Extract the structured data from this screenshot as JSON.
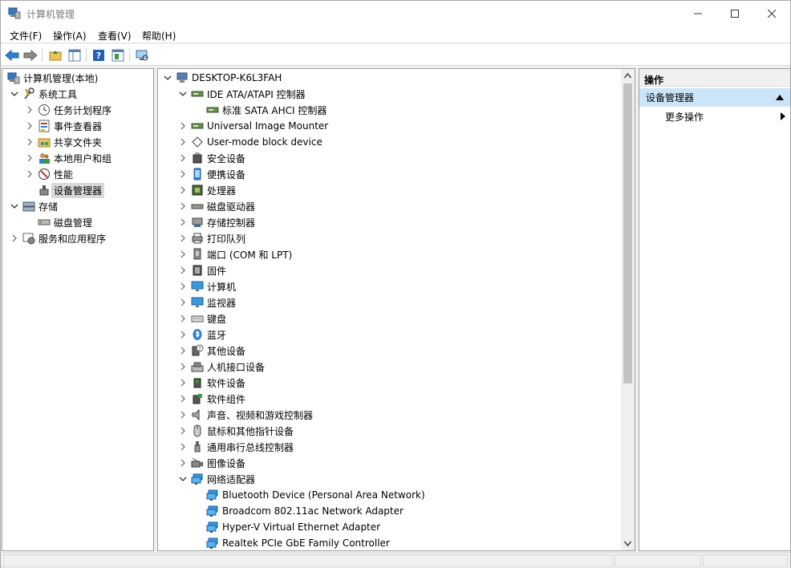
{
  "window": {
    "title": "计算机管理"
  },
  "menu": [
    "文件(F)",
    "操作(A)",
    "查看(V)",
    "帮助(H)"
  ],
  "left_tree": [
    {
      "label": "计算机管理(本地)",
      "level": 0,
      "chev": "",
      "icon": "computer-management-icon"
    },
    {
      "label": "系统工具",
      "level": 1,
      "chev": "down",
      "icon": "tools-icon"
    },
    {
      "label": "任务计划程序",
      "level": 2,
      "chev": "right",
      "icon": "clock-icon"
    },
    {
      "label": "事件查看器",
      "level": 2,
      "chev": "right",
      "icon": "event-viewer-icon"
    },
    {
      "label": "共享文件夹",
      "level": 2,
      "chev": "right",
      "icon": "shared-folder-icon"
    },
    {
      "label": "本地用户和组",
      "level": 2,
      "chev": "right",
      "icon": "users-icon"
    },
    {
      "label": "性能",
      "level": 2,
      "chev": "right",
      "icon": "performance-icon"
    },
    {
      "label": "设备管理器",
      "level": 2,
      "chev": "",
      "icon": "device-manager-icon",
      "selected": true
    },
    {
      "label": "存储",
      "level": 1,
      "chev": "down",
      "icon": "storage-icon"
    },
    {
      "label": "磁盘管理",
      "level": 2,
      "chev": "",
      "icon": "disk-management-icon"
    },
    {
      "label": "服务和应用程序",
      "level": 1,
      "chev": "right",
      "icon": "services-icon"
    }
  ],
  "device_tree": [
    {
      "label": "DESKTOP-K6L3FAH",
      "level": 0,
      "chev": "down",
      "icon": "computer-icon"
    },
    {
      "label": "IDE ATA/ATAPI 控制器",
      "level": 1,
      "chev": "down",
      "icon": "ide-controller-icon"
    },
    {
      "label": "标准 SATA AHCI 控制器",
      "level": 2,
      "chev": "",
      "icon": "ide-controller-icon"
    },
    {
      "label": "Universal Image Mounter",
      "level": 1,
      "chev": "right",
      "icon": "ide-controller-icon"
    },
    {
      "label": "User-mode block device",
      "level": 1,
      "chev": "right",
      "icon": "block-device-icon"
    },
    {
      "label": "安全设备",
      "level": 1,
      "chev": "right",
      "icon": "security-device-icon"
    },
    {
      "label": "便携设备",
      "level": 1,
      "chev": "right",
      "icon": "portable-device-icon"
    },
    {
      "label": "处理器",
      "level": 1,
      "chev": "right",
      "icon": "processor-icon"
    },
    {
      "label": "磁盘驱动器",
      "level": 1,
      "chev": "right",
      "icon": "disk-drive-icon"
    },
    {
      "label": "存储控制器",
      "level": 1,
      "chev": "right",
      "icon": "storage-controller-icon"
    },
    {
      "label": "打印队列",
      "level": 1,
      "chev": "right",
      "icon": "printer-icon"
    },
    {
      "label": "端口 (COM 和 LPT)",
      "level": 1,
      "chev": "right",
      "icon": "port-icon"
    },
    {
      "label": "固件",
      "level": 1,
      "chev": "right",
      "icon": "firmware-icon"
    },
    {
      "label": "计算机",
      "level": 1,
      "chev": "right",
      "icon": "monitor-icon"
    },
    {
      "label": "监视器",
      "level": 1,
      "chev": "right",
      "icon": "monitor-icon"
    },
    {
      "label": "键盘",
      "level": 1,
      "chev": "right",
      "icon": "keyboard-icon"
    },
    {
      "label": "蓝牙",
      "level": 1,
      "chev": "right",
      "icon": "bluetooth-icon"
    },
    {
      "label": "其他设备",
      "level": 1,
      "chev": "right",
      "icon": "unknown-device-icon"
    },
    {
      "label": "人机接口设备",
      "level": 1,
      "chev": "right",
      "icon": "hid-icon"
    },
    {
      "label": "软件设备",
      "level": 1,
      "chev": "right",
      "icon": "software-device-icon"
    },
    {
      "label": "软件组件",
      "level": 1,
      "chev": "right",
      "icon": "software-component-icon"
    },
    {
      "label": "声音、视频和游戏控制器",
      "level": 1,
      "chev": "right",
      "icon": "speaker-icon"
    },
    {
      "label": "鼠标和其他指针设备",
      "level": 1,
      "chev": "right",
      "icon": "mouse-icon"
    },
    {
      "label": "通用串行总线控制器",
      "level": 1,
      "chev": "right",
      "icon": "usb-icon"
    },
    {
      "label": "图像设备",
      "level": 1,
      "chev": "right",
      "icon": "camera-icon"
    },
    {
      "label": "网络适配器",
      "level": 1,
      "chev": "down",
      "icon": "network-adapter-icon"
    },
    {
      "label": "Bluetooth Device (Personal Area Network)",
      "level": 2,
      "chev": "",
      "icon": "network-adapter-icon"
    },
    {
      "label": "Broadcom 802.11ac Network Adapter",
      "level": 2,
      "chev": "",
      "icon": "network-adapter-icon"
    },
    {
      "label": "Hyper-V Virtual Ethernet Adapter",
      "level": 2,
      "chev": "",
      "icon": "network-adapter-icon"
    },
    {
      "label": "Realtek PCIe GbE Family Controller",
      "level": 2,
      "chev": "",
      "icon": "network-adapter-icon"
    }
  ],
  "actions": {
    "header": "操作",
    "section": "设备管理器",
    "more": "更多操作"
  }
}
